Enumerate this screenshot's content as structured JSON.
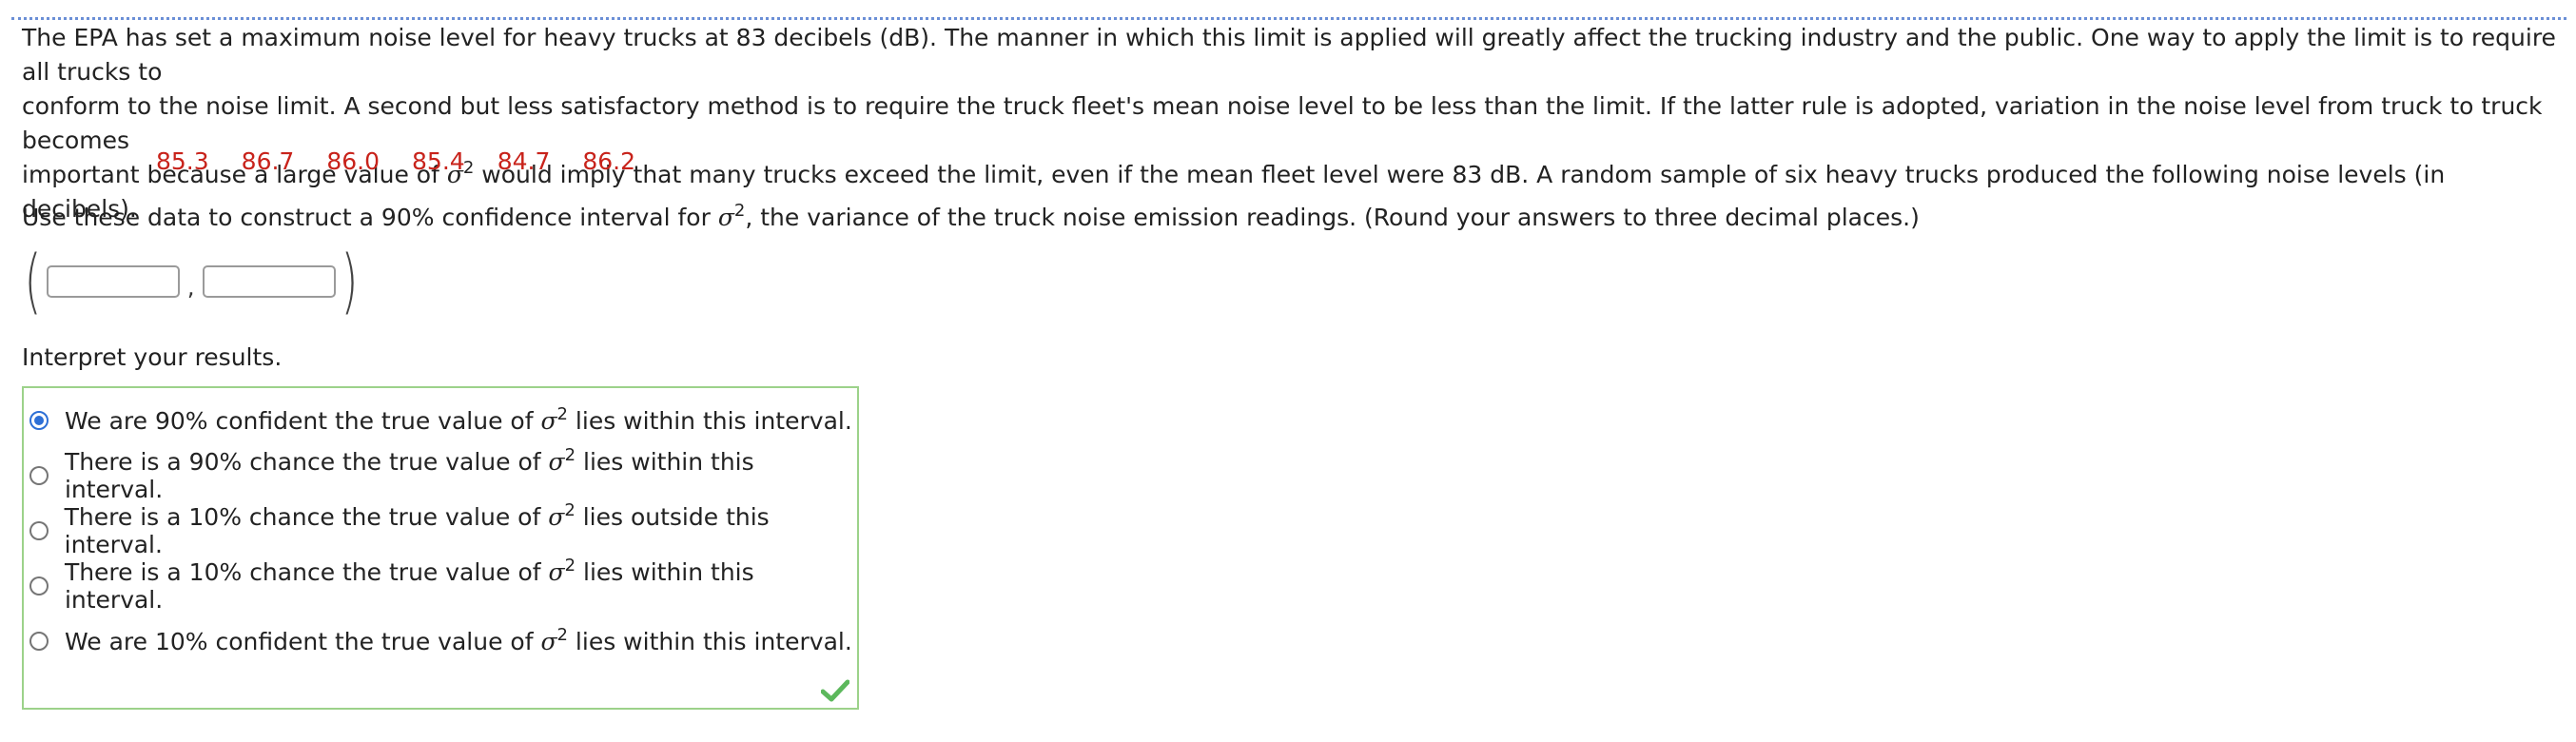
{
  "problem": {
    "line1": "The EPA has set a maximum noise level for heavy trucks at 83 decibels (dB). The manner in which this limit is applied will greatly affect the trucking industry and the public. One way to apply the limit is to require all trucks to",
    "line2": "conform to the noise limit. A second but less satisfactory method is to require the truck fleet's mean noise level to be less than the limit. If the latter rule is adopted, variation in the noise level from truck to truck becomes",
    "line3_before": "important because a large value of ",
    "line3_after": " would imply that many trucks exceed the limit, even if the mean fleet level were 83 dB. A random sample of six heavy trucks produced the following noise levels (in decibels)."
  },
  "symbols": {
    "sigma": "σ",
    "squared": "2"
  },
  "data_values": [
    "85.3",
    "86.7",
    "86.0",
    "85.4",
    "84.7",
    "86.2"
  ],
  "question": {
    "before": "Use these data to construct a 90% confidence interval for ",
    "after": ", the variance of the truck noise emission readings. (Round your answers to three decimal places.)"
  },
  "interval": {
    "open_paren": "(",
    "close_paren": ")",
    "separator": ",",
    "lower_value": "",
    "upper_value": ""
  },
  "interpret": {
    "label": "Interpret your results.",
    "options": [
      {
        "before": "We are 90% confident the true value of ",
        "after": " lies within this interval.",
        "selected": true
      },
      {
        "before": "There is a 90% chance the true value of ",
        "after": " lies within this interval.",
        "selected": false
      },
      {
        "before": "There is a 10% chance the true value of ",
        "after": " lies outside this interval.",
        "selected": false
      },
      {
        "before": "There is a 10% chance the true value of ",
        "after": " lies within this interval.",
        "selected": false
      },
      {
        "before": "We are 10% confident the true value of ",
        "after": " lies within this interval.",
        "selected": false
      }
    ],
    "feedback_icon": "checkmark-icon"
  },
  "colors": {
    "data_text": "#c8231b",
    "radio_selected": "#2d6fd6",
    "answer_box_border": "#9cd28a",
    "check_icon": "#5cb85c",
    "top_rule": "#6b8fd6"
  }
}
